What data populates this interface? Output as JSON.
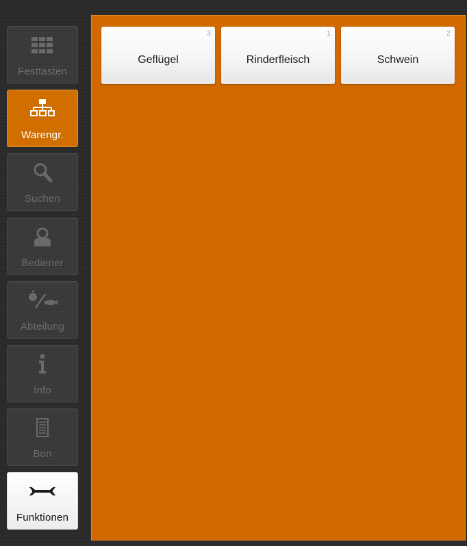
{
  "sidebar": {
    "items": [
      {
        "label": "Festtasten",
        "icon": "grid-icon",
        "state": "disabled"
      },
      {
        "label": "Warengr.",
        "icon": "sitemap-icon",
        "state": "active"
      },
      {
        "label": "Suchen",
        "icon": "search-icon",
        "state": "disabled"
      },
      {
        "label": "Bediener",
        "icon": "user-icon",
        "state": "disabled"
      },
      {
        "label": "Abteilung",
        "icon": "meat-fish-icon",
        "state": "disabled"
      },
      {
        "label": "Info",
        "icon": "info-icon",
        "state": "disabled"
      },
      {
        "label": "Bon",
        "icon": "receipt-icon",
        "state": "disabled"
      },
      {
        "label": "Funktionen",
        "icon": "wrench-icon",
        "state": "normal"
      }
    ]
  },
  "product_groups": [
    {
      "name": "Geflügel",
      "count": "3"
    },
    {
      "name": "Rinderfleisch",
      "count": "1"
    },
    {
      "name": "Schwein",
      "count": "2"
    }
  ],
  "colors": {
    "accent": "#d16800",
    "background": "#2b2b2b",
    "tile": "#ffffff"
  }
}
